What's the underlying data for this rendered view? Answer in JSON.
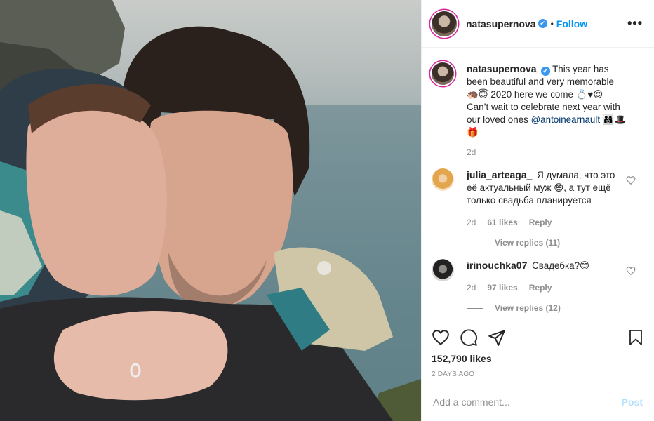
{
  "post": {
    "username": "natasupernova",
    "verified_mark": "✔",
    "separator": "•",
    "follow_label": "Follow",
    "more_label": "•••"
  },
  "caption": {
    "username": "natasupernova",
    "text_1": "This year has been beautiful and very memorable 🦔😇 2020 here we come 💍♥😍 Can’t wait to celebrate next year with our loved ones ",
    "mention": "@antoinearnault",
    "text_2": " 👨‍👩‍👧🎩🎁",
    "age": "2d"
  },
  "comments": [
    {
      "username": "julia_arteaga_",
      "text": "Я думала, что это её актуальный муж 😄, а тут ещё только свадьба планируется",
      "age": "2d",
      "likes": "61 likes",
      "reply_label": "Reply",
      "view_replies": "View replies (11)"
    },
    {
      "username": "irinouchka07",
      "text": "Свадебка?😊",
      "age": "2d",
      "likes": "97 likes",
      "reply_label": "Reply",
      "view_replies": "View replies (12)"
    }
  ],
  "stats": {
    "likes": "152,790 likes",
    "time_ago": "2 DAYS AGO"
  },
  "add_comment": {
    "placeholder": "Add a comment...",
    "post_label": "Post"
  },
  "icons": {
    "header": [
      "avatar",
      "verified-badge",
      "more-options-icon"
    ],
    "actions": [
      "heart-icon",
      "comment-icon",
      "share-icon",
      "bookmark-icon"
    ]
  },
  "colors": {
    "follow_blue": "#0095f6",
    "verified_blue": "#3897f0",
    "post_disabled": "#b2dffc",
    "muted_gray": "#8e8e8e"
  }
}
